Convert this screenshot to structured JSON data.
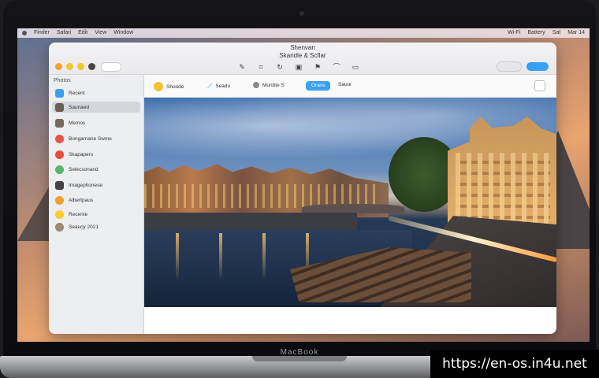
{
  "menubar": {
    "left": [
      "Finder",
      "Safari",
      "Edit",
      "View",
      "Window"
    ],
    "right": [
      "Wi-Fi",
      "Battery",
      "Sat",
      "Mar 14"
    ]
  },
  "window": {
    "title_line1": "Shenvan",
    "title_line2": "Skandle & Scflar",
    "toolbar_tools": [
      "pen-icon",
      "crop-icon",
      "rotate-icon",
      "image-icon",
      "flag-icon",
      "curve-icon",
      "trash-icon"
    ]
  },
  "sidebar": {
    "header": "Photos",
    "items": [
      {
        "label": "Recent",
        "color": "#3aa0f2"
      },
      {
        "label": "Saunaed",
        "color": "#6b5e58",
        "selected": true
      },
      {
        "label": "Memos",
        "color": "#7a6a5c"
      },
      {
        "label": "Bongamane Swme",
        "color": "#e6554a"
      },
      {
        "label": "Skapapers",
        "color": "#e94c3f"
      },
      {
        "label": "Selecsonand",
        "color": "#5ab56a"
      },
      {
        "label": "Imagephonese",
        "color": "#444444"
      },
      {
        "label": "Albertpaus",
        "color": "#f0a030"
      },
      {
        "label": "Recente",
        "color": "#ffcc30"
      },
      {
        "label": "Seaucy 2021",
        "color": "#9a8a70"
      }
    ]
  },
  "content_toolbar": {
    "items": [
      {
        "label": "Shoode",
        "color": "#f2c230"
      },
      {
        "label": "Seadu",
        "color": "#3aa0f2"
      },
      {
        "label": "Munbte S",
        "color": "#888888"
      }
    ],
    "active_button": "Orass",
    "last_item": "Sauoi"
  },
  "dock": [
    "#3a5a8a",
    "#2a7ab0",
    "#3a6fb0",
    "#2fbf8f",
    "#e0508a",
    "#5ac8f0",
    "#e6e6e6",
    "#f5d86a",
    "#40c0a0",
    "#f28a30",
    "#f07030",
    "#3aa0f2",
    "#6ab0f0",
    "#a090f0",
    "#e05050",
    "#2f9f70",
    "#f05a7a",
    "#8a8ac0",
    "#2a3a5a",
    "#3ab0f0"
  ],
  "laptop_brand": "MacBook",
  "watermark": "https://en-os.in4u.net"
}
